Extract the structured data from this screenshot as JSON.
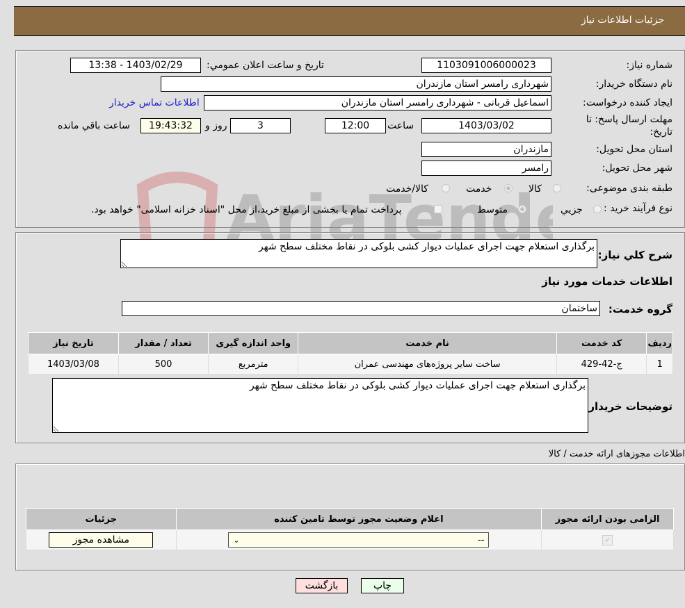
{
  "header": {
    "title": "جزئیات اطلاعات نیاز"
  },
  "details": {
    "need_number_label": "شماره نیاز:",
    "need_number": "1103091006000023",
    "announce_label": "تاریخ و ساعت اعلان عمومي:",
    "announce_value": "1403/02/29 - 13:38",
    "buyer_org_label": "نام دستگاه خریدار:",
    "buyer_org": "شهرداری رامسر استان مازندران",
    "creator_label": "ایجاد کننده درخواست:",
    "creator": "اسماعیل قربانی - شهرداری رامسر استان مازندران",
    "contact_link": "اطلاعات تماس خریدار",
    "deadline_label_line1": "مهلت ارسال پاسخ: تا",
    "deadline_label_line2": "تاریخ:",
    "deadline_date": "1403/03/02",
    "time_label": "ساعت",
    "deadline_time": "12:00",
    "days_value": "3",
    "days_label": "روز و",
    "remaining_time": "19:43:32",
    "remaining_label": "ساعت باقي مانده",
    "province_label": "استان محل تحویل:",
    "province": "مازندران",
    "city_label": "شهر محل تحویل:",
    "city": "رامسر",
    "category_label": "طبقه بندی موضوعی:",
    "category_options": [
      {
        "label": "کالا",
        "checked": false
      },
      {
        "label": "خدمت",
        "checked": true
      },
      {
        "label": "کالا/خدمت",
        "checked": false
      }
    ],
    "process_label": "نوع فرآیند خرید :",
    "process_options": [
      {
        "label": "جزیي",
        "checked": false
      },
      {
        "label": "متوسط",
        "checked": true
      }
    ],
    "treasury_note": "پرداخت تمام یا بخشی از مبلغ خرید،از محل \"اسناد خزانه اسلامی\" خواهد بود.",
    "treasury_checked": false
  },
  "summary": {
    "description_label": "شرح کلي نیاز:",
    "description": "برگذاری استعلام جهت اجرای عملیات دیوار کشی بلوکی در نقاط مختلف سطح شهر",
    "services_heading": "اطلاعات خدمات مورد نیاز",
    "service_group_label": "گروه خدمت:",
    "service_group": "ساختمان",
    "table": {
      "headers": [
        "ردیف",
        "کد خدمت",
        "نام خدمت",
        "واحد اندازه گیری",
        "تعداد / مقدار",
        "تاریخ نیاز"
      ],
      "rows": [
        [
          "1",
          "ج-42-429",
          "ساخت سایر پروژه‌های مهندسی عمران",
          "مترمربع",
          "500",
          "1403/03/08"
        ]
      ]
    },
    "buyer_notes_label": "توضیحات خریدار:",
    "buyer_notes": "برگذاری استعلام جهت اجرای عملیات دیوار کشی بلوکی در نقاط مختلف سطح شهر"
  },
  "permits": {
    "heading": "اطلاعات مجوزهای ارائه خدمت / کالا",
    "headers": [
      "الزامی بودن ارائه مجوز",
      "اعلام وضعیت مجوز توسط تامین کننده",
      "جزئیات"
    ],
    "row": {
      "required_checked": true,
      "status_selected": "--",
      "view_button": "مشاهده مجوز"
    }
  },
  "footer": {
    "print_button": "چاپ",
    "back_button": "بازگشت"
  },
  "colors": {
    "header_bg": "#8b6b41",
    "print_bg": "#eaffea",
    "back_bg": "#ffdede",
    "link": "#2222cc"
  }
}
